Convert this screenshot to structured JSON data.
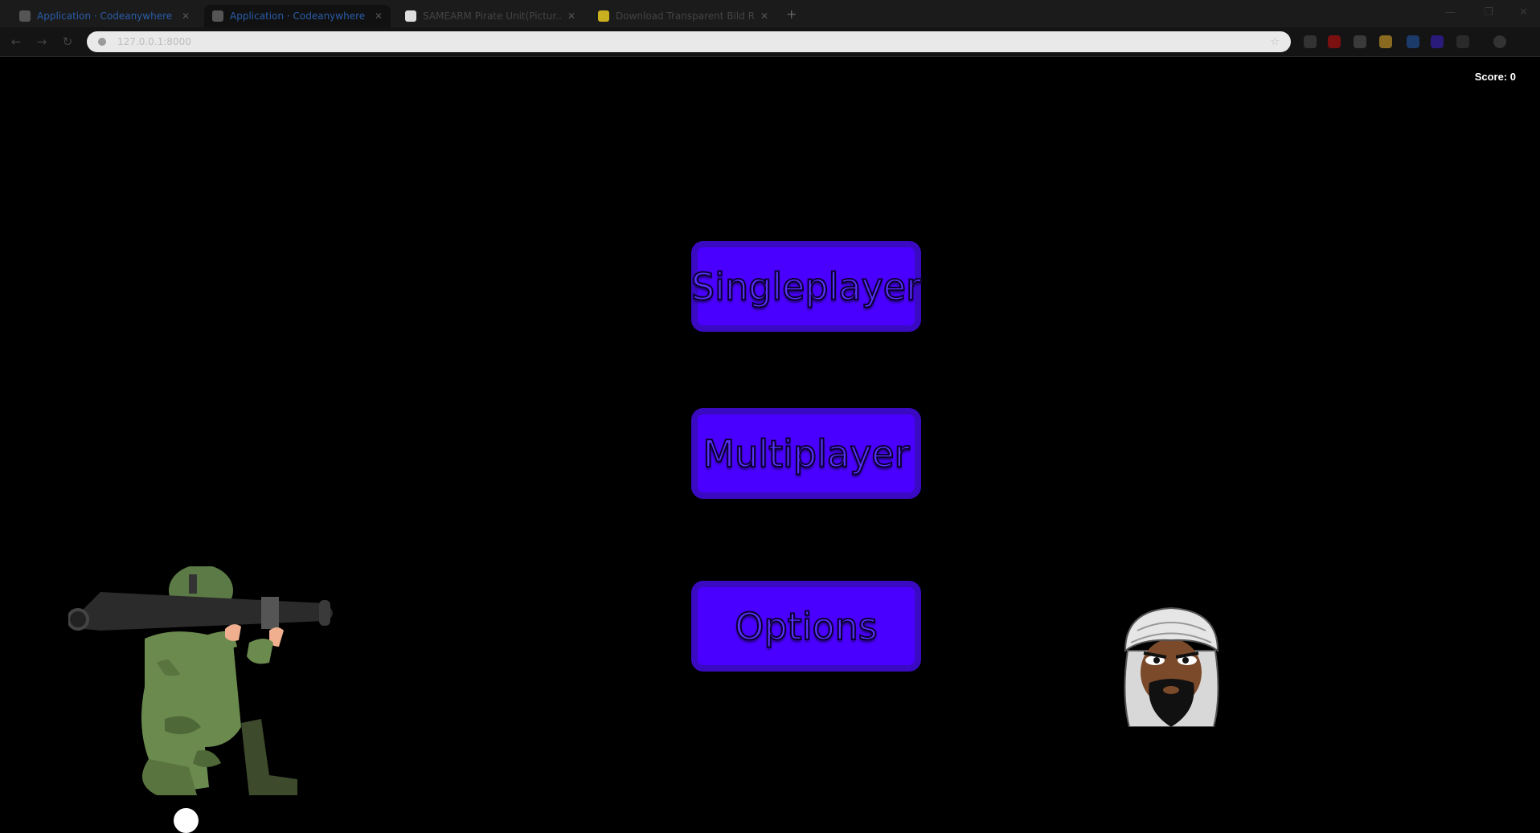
{
  "browser": {
    "tabs": [
      {
        "title": "Application · Codeanywhere",
        "active": false
      },
      {
        "title": "Application · Codeanywhere",
        "active": true
      },
      {
        "title": "SAMEARM Pirate Unit(Pictur...",
        "active": false
      },
      {
        "title": "Download Transparent Bild Ro...",
        "active": false
      }
    ],
    "new_tab_label": "+",
    "address": "127.0.0.1:8000",
    "colors": {
      "tab_text": "#2a5da8"
    }
  },
  "game": {
    "score_text": "Score: 0",
    "buttons": {
      "singleplayer": "Singleplayer",
      "multiplayer": "Multiplayer",
      "options": "Options"
    },
    "colors": {
      "button_fill": "#4a00ff",
      "button_border": "#3a0ac2",
      "background": "#000000"
    },
    "characters": [
      {
        "name": "soldier-with-cannon",
        "icon": "soldier-icon"
      },
      {
        "name": "turbaned-man",
        "icon": "turban-man-icon"
      }
    ]
  }
}
